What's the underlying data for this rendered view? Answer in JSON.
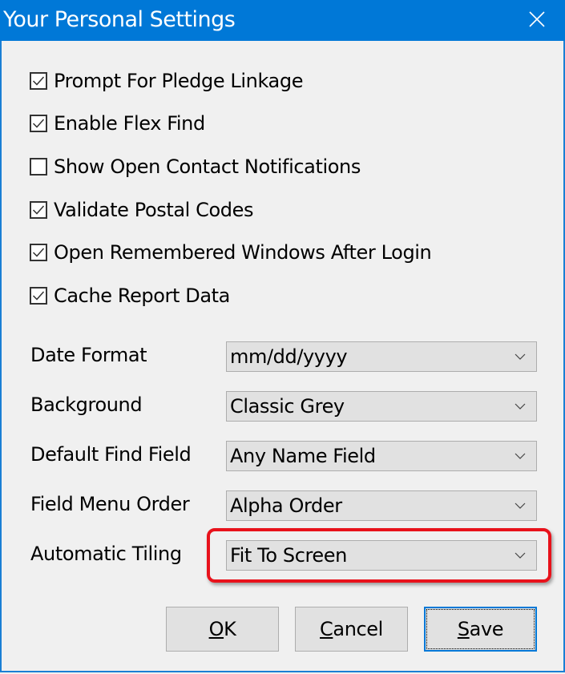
{
  "window": {
    "title": "Your Personal Settings",
    "close_icon": "close-icon",
    "accent_color": "#0078d7"
  },
  "checkboxes": [
    {
      "label": "Prompt For Pledge Linkage",
      "checked": true
    },
    {
      "label": "Enable Flex Find",
      "checked": true
    },
    {
      "label": "Show Open Contact Notifications",
      "checked": false
    },
    {
      "label": "Validate Postal Codes",
      "checked": true
    },
    {
      "label": "Open Remembered Windows After Login",
      "checked": true
    },
    {
      "label": "Cache Report Data",
      "checked": true
    }
  ],
  "fields": [
    {
      "label": "Date Format",
      "value": "mm/dd/yyyy"
    },
    {
      "label": "Background",
      "value": "Classic Grey"
    },
    {
      "label": "Default Find Field",
      "value": "Any Name Field"
    },
    {
      "label": "Field Menu Order",
      "value": "Alpha Order"
    },
    {
      "label": "Automatic Tiling",
      "value": "Fit To Screen",
      "highlighted": true
    }
  ],
  "highlight_color": "#e8121b",
  "buttons": {
    "ok": {
      "mnemonic": "O",
      "rest": "K"
    },
    "cancel": {
      "mnemonic": "C",
      "rest": "ancel"
    },
    "save": {
      "mnemonic": "S",
      "rest": "ave",
      "default": true
    }
  }
}
